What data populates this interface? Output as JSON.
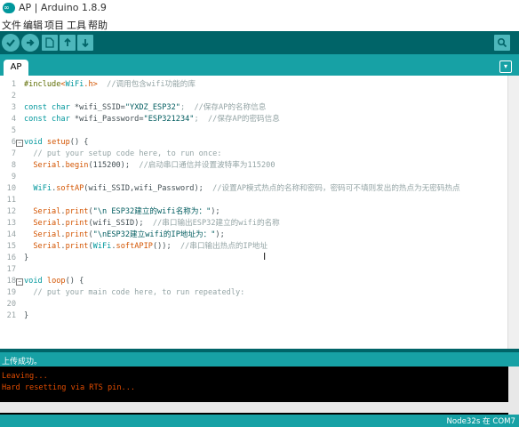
{
  "window": {
    "title": "AP | Arduino 1.8.9",
    "logo_text": "∞"
  },
  "menu": [
    "文件",
    "编辑",
    "项目",
    "工具",
    "帮助"
  ],
  "toolbar": {
    "verify_icon": "check-icon",
    "upload_icon": "arrow-right-icon",
    "new_icon": "new-file-icon",
    "open_icon": "arrow-up-icon",
    "save_icon": "arrow-down-icon",
    "serial_icon": "magnifier-icon"
  },
  "tabs": {
    "active": "AP",
    "menu_glyph": "▾"
  },
  "code_lines": [
    {
      "n": "1",
      "segs": [
        {
          "t": "#include",
          "c": "pp"
        },
        {
          "t": "<",
          "c": "inc"
        },
        {
          "t": "WiFi",
          "c": "kw"
        },
        {
          "t": ".h>",
          "c": "inc"
        },
        {
          "t": "  //调用包含wifi功能的库",
          "c": "cmt"
        }
      ]
    },
    {
      "n": "2",
      "segs": []
    },
    {
      "n": "3",
      "segs": [
        {
          "t": "const ",
          "c": "kw"
        },
        {
          "t": "char",
          "c": "kw"
        },
        {
          "t": " *wifi_SSID=",
          "c": ""
        },
        {
          "t": "\"YXDZ_ESP32\"",
          "c": "str"
        },
        {
          "t": ";  //保存AP的名称信息",
          "c": "cmt"
        }
      ]
    },
    {
      "n": "4",
      "segs": [
        {
          "t": "const ",
          "c": "kw"
        },
        {
          "t": "char",
          "c": "kw"
        },
        {
          "t": " *wifi_Password=",
          "c": ""
        },
        {
          "t": "\"ESP321234\"",
          "c": "str"
        },
        {
          "t": ";  //保存AP的密码信息",
          "c": "cmt"
        }
      ]
    },
    {
      "n": "5",
      "segs": []
    },
    {
      "n": "6",
      "segs": [
        {
          "t": "void",
          "c": "kw"
        },
        {
          "t": " ",
          "c": ""
        },
        {
          "t": "setup",
          "c": "fn"
        },
        {
          "t": "() {",
          "c": ""
        }
      ],
      "fold": true
    },
    {
      "n": "7",
      "segs": [
        {
          "t": "  // put your setup code here, to run once:",
          "c": "cmt"
        }
      ]
    },
    {
      "n": "8",
      "segs": [
        {
          "t": "  ",
          "c": ""
        },
        {
          "t": "Serial",
          "c": "fn"
        },
        {
          "t": ".",
          "c": ""
        },
        {
          "t": "begin",
          "c": "fn"
        },
        {
          "t": "(115200);  ",
          "c": ""
        },
        {
          "t": "//启动串口通信并设置波特率为115200",
          "c": "cmt"
        }
      ]
    },
    {
      "n": "9",
      "segs": []
    },
    {
      "n": "10",
      "segs": [
        {
          "t": "  ",
          "c": ""
        },
        {
          "t": "WiFi",
          "c": "kw"
        },
        {
          "t": ".",
          "c": ""
        },
        {
          "t": "softAP",
          "c": "fn"
        },
        {
          "t": "(wifi_SSID,wifi_Password);  ",
          "c": ""
        },
        {
          "t": "//设置AP模式热点的名称和密码，密码可不填则发出的热点为无密码热点",
          "c": "cmt"
        }
      ]
    },
    {
      "n": "11",
      "segs": []
    },
    {
      "n": "12",
      "segs": [
        {
          "t": "  ",
          "c": ""
        },
        {
          "t": "Serial",
          "c": "fn"
        },
        {
          "t": ".",
          "c": ""
        },
        {
          "t": "print",
          "c": "fn"
        },
        {
          "t": "(",
          "c": ""
        },
        {
          "t": "\"\\n ESP32建立的wifi名称为：\"",
          "c": "str"
        },
        {
          "t": ");",
          "c": ""
        }
      ]
    },
    {
      "n": "13",
      "segs": [
        {
          "t": "  ",
          "c": ""
        },
        {
          "t": "Serial",
          "c": "fn"
        },
        {
          "t": ".",
          "c": ""
        },
        {
          "t": "print",
          "c": "fn"
        },
        {
          "t": "(wifi_SSID);  ",
          "c": ""
        },
        {
          "t": "//串口输出ESP32建立的wifi的名称",
          "c": "cmt"
        }
      ]
    },
    {
      "n": "14",
      "segs": [
        {
          "t": "  ",
          "c": ""
        },
        {
          "t": "Serial",
          "c": "fn"
        },
        {
          "t": ".",
          "c": ""
        },
        {
          "t": "print",
          "c": "fn"
        },
        {
          "t": "(",
          "c": ""
        },
        {
          "t": "\"\\nESP32建立wifi的IP地址为：\"",
          "c": "str"
        },
        {
          "t": ");",
          "c": ""
        }
      ]
    },
    {
      "n": "15",
      "segs": [
        {
          "t": "  ",
          "c": ""
        },
        {
          "t": "Serial",
          "c": "fn"
        },
        {
          "t": ".",
          "c": ""
        },
        {
          "t": "print",
          "c": "fn"
        },
        {
          "t": "(",
          "c": ""
        },
        {
          "t": "WiFi",
          "c": "kw"
        },
        {
          "t": ".",
          "c": ""
        },
        {
          "t": "softAPIP",
          "c": "fn"
        },
        {
          "t": "());  ",
          "c": ""
        },
        {
          "t": "//串口输出热点的IP地址",
          "c": "cmt"
        }
      ]
    },
    {
      "n": "16",
      "segs": [
        {
          "t": "}",
          "c": ""
        }
      ]
    },
    {
      "n": "17",
      "segs": []
    },
    {
      "n": "18",
      "segs": [
        {
          "t": "void",
          "c": "kw"
        },
        {
          "t": " ",
          "c": ""
        },
        {
          "t": "loop",
          "c": "fn"
        },
        {
          "t": "() {",
          "c": ""
        }
      ],
      "fold": true
    },
    {
      "n": "19",
      "segs": [
        {
          "t": "  // put your main code here, to run repeatedly:",
          "c": "cmt"
        }
      ]
    },
    {
      "n": "20",
      "segs": []
    },
    {
      "n": "21",
      "segs": [
        {
          "t": "}",
          "c": ""
        }
      ]
    }
  ],
  "status": {
    "message": "上传成功。"
  },
  "console": [
    "Leaving...",
    "Hard resetting via RTS pin..."
  ],
  "board_status": "Node32s 在 COM7"
}
